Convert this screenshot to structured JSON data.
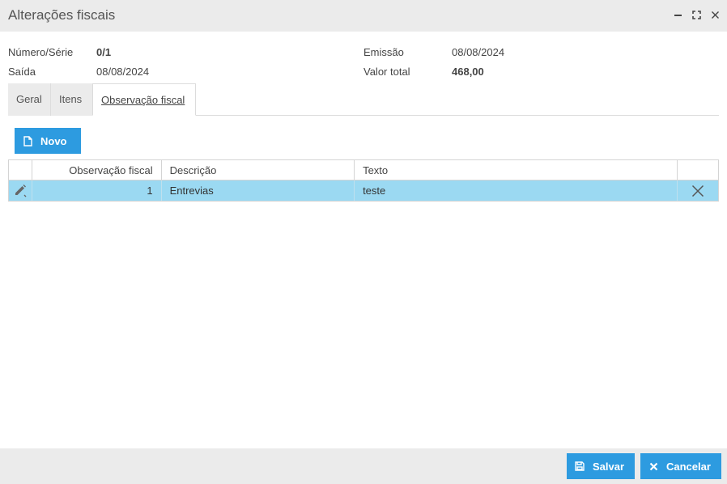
{
  "window": {
    "title": "Alterações fiscais"
  },
  "header": {
    "numero_label": "Número/Série",
    "numero_value": "0/1",
    "saida_label": "Saída",
    "saida_value": "08/08/2024",
    "emissao_label": "Emissão",
    "emissao_value": "08/08/2024",
    "valor_label": "Valor total",
    "valor_value": "468,00"
  },
  "tabs": [
    {
      "label": "Geral"
    },
    {
      "label": "Itens"
    },
    {
      "label": "Observação fiscal",
      "active": true
    }
  ],
  "toolbar": {
    "novo_label": "Novo"
  },
  "grid": {
    "columns": [
      "",
      "Observação fiscal",
      "Descrição",
      "Texto",
      ""
    ],
    "rows": [
      {
        "observacao": "1",
        "descricao": "Entrevias",
        "texto": "teste"
      }
    ]
  },
  "footer": {
    "salvar_label": "Salvar",
    "cancelar_label": "Cancelar"
  },
  "colors": {
    "accent": "#2d9be0",
    "selected_row": "#9bd9f2",
    "titlebar": "#ebebeb"
  }
}
